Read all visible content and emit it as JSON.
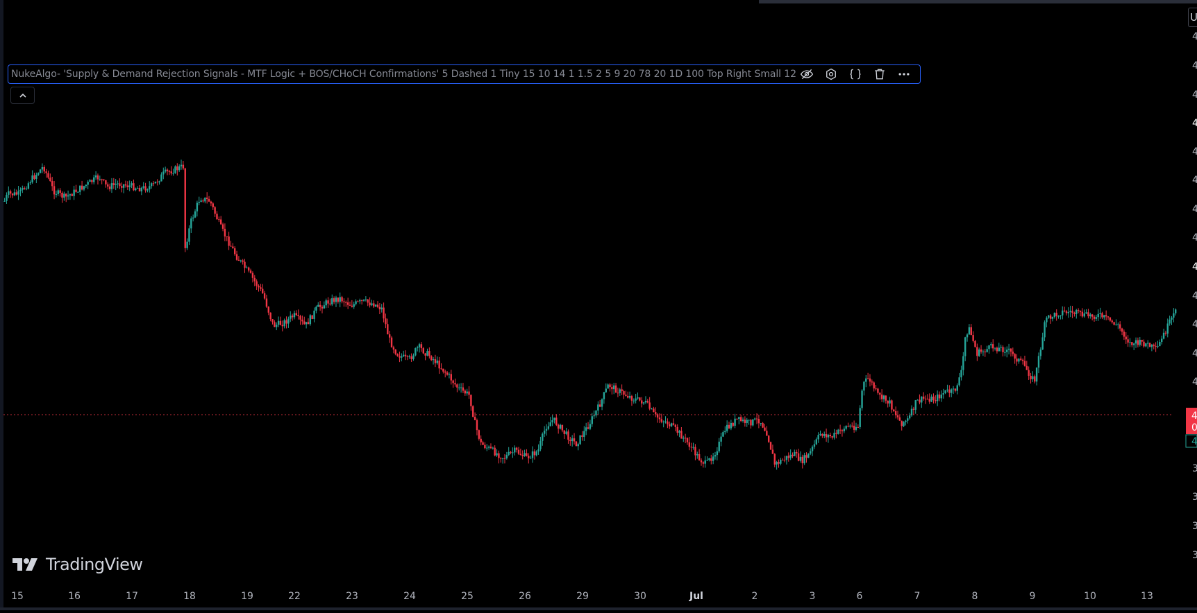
{
  "indicator": {
    "label": "NukeAlgo- 'Supply & Demand Rejection Signals - MTF Logic + BOS/CHoCH Confirmations' 5 Dashed 1 Tiny 15 10 14 1 1.5 2 5 9 20 78 20 1D 100 Top Right Small 12",
    "icons": [
      "eye-off-icon",
      "settings-icon",
      "source-code-icon",
      "trash-icon",
      "more-icon"
    ]
  },
  "branding": {
    "logo_text": "TradingView"
  },
  "price_axis": {
    "top_label": "U",
    "ticks": [
      "4",
      "4",
      "4",
      "4",
      "4",
      "4",
      "4",
      "4",
      "4",
      "4",
      "4",
      "4",
      "4",
      "3",
      "3",
      "3",
      "3"
    ],
    "current_price_label": "4\n0",
    "secondary_label": "4"
  },
  "colors": {
    "up": "#26a69a",
    "down": "#f23645",
    "background": "#000000",
    "grid": "#000000",
    "axis_text": "#b2b5be",
    "current_price_line": "#f23645",
    "indicator_border": "#2962ff"
  },
  "chart_data": {
    "type": "candlestick",
    "title": "",
    "x_ticks": [
      "15",
      "16",
      "17",
      "18",
      "19",
      "22",
      "23",
      "24",
      "25",
      "26",
      "29",
      "30",
      "Jul",
      "2",
      "3",
      "6",
      "7",
      "8",
      "9",
      "10",
      "13"
    ],
    "y_range_estimate": "unlabeled price axis (values cut off)",
    "series": [
      {
        "name": "",
        "path_points": [
          [
            0,
            305
          ],
          [
            10,
            280
          ],
          [
            25,
            280
          ],
          [
            40,
            260
          ],
          [
            57,
            240
          ],
          [
            70,
            275
          ],
          [
            85,
            285
          ],
          [
            100,
            275
          ],
          [
            115,
            265
          ],
          [
            130,
            255
          ],
          [
            140,
            270
          ],
          [
            155,
            265
          ],
          [
            170,
            268
          ],
          [
            185,
            272
          ],
          [
            200,
            268
          ],
          [
            215,
            250
          ],
          [
            240,
            240
          ],
          [
            242,
            360
          ],
          [
            250,
            320
          ],
          [
            262,
            285
          ],
          [
            275,
            290
          ],
          [
            290,
            330
          ],
          [
            310,
            370
          ],
          [
            330,
            400
          ],
          [
            345,
            425
          ],
          [
            358,
            470
          ],
          [
            372,
            465
          ],
          [
            385,
            455
          ],
          [
            400,
            470
          ],
          [
            415,
            445
          ],
          [
            430,
            435
          ],
          [
            445,
            430
          ],
          [
            460,
            440
          ],
          [
            475,
            435
          ],
          [
            490,
            438
          ],
          [
            500,
            445
          ],
          [
            510,
            490
          ],
          [
            520,
            510
          ],
          [
            535,
            520
          ],
          [
            548,
            500
          ],
          [
            565,
            515
          ],
          [
            578,
            530
          ],
          [
            590,
            545
          ],
          [
            600,
            560
          ],
          [
            615,
            570
          ],
          [
            622,
            610
          ],
          [
            630,
            640
          ],
          [
            645,
            650
          ],
          [
            660,
            660
          ],
          [
            675,
            650
          ],
          [
            690,
            660
          ],
          [
            705,
            650
          ],
          [
            715,
            615
          ],
          [
            725,
            605
          ],
          [
            740,
            625
          ],
          [
            755,
            640
          ],
          [
            770,
            615
          ],
          [
            785,
            585
          ],
          [
            797,
            555
          ],
          [
            812,
            565
          ],
          [
            830,
            575
          ],
          [
            845,
            580
          ],
          [
            858,
            600
          ],
          [
            875,
            610
          ],
          [
            890,
            625
          ],
          [
            902,
            640
          ],
          [
            915,
            660
          ],
          [
            925,
            670
          ],
          [
            938,
            650
          ],
          [
            950,
            620
          ],
          [
            965,
            605
          ],
          [
            980,
            610
          ],
          [
            995,
            605
          ],
          [
            1005,
            625
          ],
          [
            1015,
            670
          ],
          [
            1030,
            660
          ],
          [
            1040,
            655
          ],
          [
            1050,
            665
          ],
          [
            1060,
            655
          ],
          [
            1075,
            625
          ],
          [
            1090,
            630
          ],
          [
            1108,
            615
          ],
          [
            1124,
            615
          ],
          [
            1130,
            555
          ],
          [
            1138,
            545
          ],
          [
            1150,
            570
          ],
          [
            1165,
            580
          ],
          [
            1180,
            610
          ],
          [
            1190,
            605
          ],
          [
            1200,
            580
          ],
          [
            1210,
            575
          ],
          [
            1225,
            575
          ],
          [
            1238,
            565
          ],
          [
            1250,
            565
          ],
          [
            1260,
            535
          ],
          [
            1265,
            480
          ],
          [
            1270,
            475
          ],
          [
            1280,
            510
          ],
          [
            1300,
            500
          ],
          [
            1320,
            505
          ],
          [
            1340,
            525
          ],
          [
            1355,
            550
          ],
          [
            1370,
            460
          ],
          [
            1390,
            450
          ],
          [
            1405,
            450
          ],
          [
            1420,
            455
          ],
          [
            1440,
            455
          ],
          [
            1450,
            460
          ],
          [
            1465,
            470
          ],
          [
            1480,
            495
          ],
          [
            1500,
            495
          ],
          [
            1515,
            505
          ],
          [
            1530,
            470
          ],
          [
            1540,
            450
          ],
          [
            1560,
            500
          ],
          [
            1580,
            520
          ],
          [
            1600,
            505
          ],
          [
            1615,
            495
          ],
          [
            1630,
            490
          ],
          [
            1645,
            495
          ],
          [
            1660,
            500
          ],
          [
            1670,
            525
          ],
          [
            1680,
            520
          ],
          [
            1688,
            545
          ],
          [
            1700,
            640
          ],
          [
            1712,
            645
          ]
        ]
      }
    ],
    "current_price_line": "dotted"
  }
}
